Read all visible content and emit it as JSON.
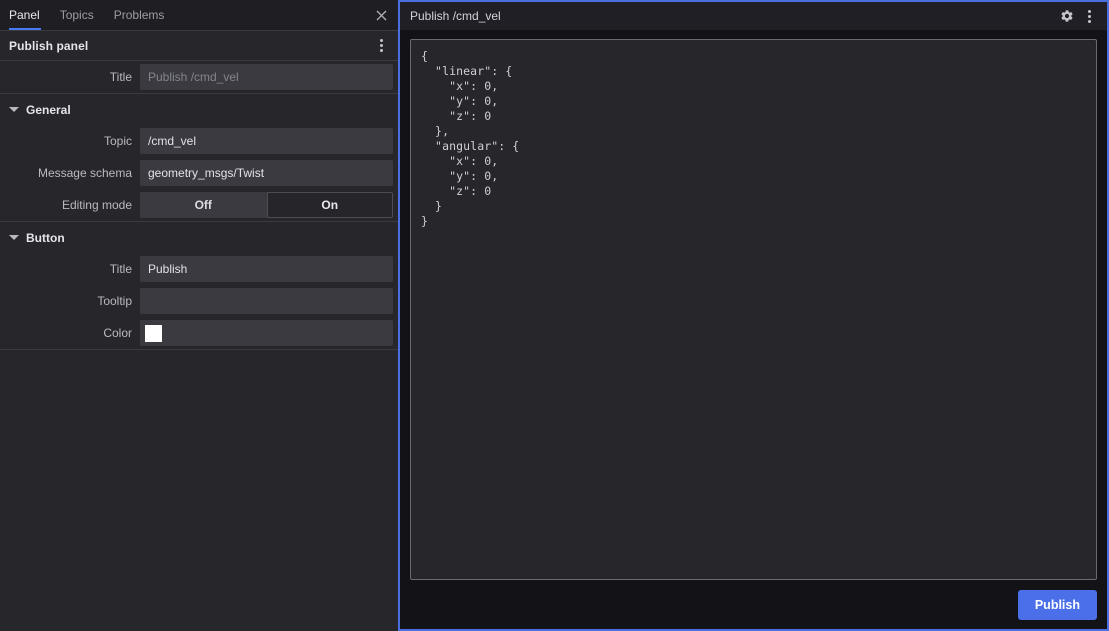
{
  "sidebar": {
    "tabs": [
      {
        "label": "Panel",
        "active": true
      },
      {
        "label": "Topics",
        "active": false
      },
      {
        "label": "Problems",
        "active": false
      }
    ],
    "close_icon": "close-icon",
    "panel_header": {
      "title": "Publish panel",
      "menu_icon": "kebab-menu-icon"
    },
    "title_row": {
      "label": "Title",
      "value": "",
      "placeholder": "Publish /cmd_vel"
    },
    "sections": [
      {
        "name": "general",
        "title": "General",
        "expanded": true,
        "caret_icon": "chevron-down-icon",
        "rows": [
          {
            "label": "Topic",
            "type": "text",
            "value": "/cmd_vel",
            "placeholder": ""
          },
          {
            "label": "Message schema",
            "type": "text",
            "value": "geometry_msgs/Twist",
            "placeholder": ""
          },
          {
            "label": "Editing mode",
            "type": "toggle",
            "options": [
              "Off",
              "On"
            ],
            "selected": "On"
          }
        ]
      },
      {
        "name": "button",
        "title": "Button",
        "expanded": true,
        "caret_icon": "chevron-down-icon",
        "rows": [
          {
            "label": "Title",
            "type": "text",
            "value": "Publish",
            "placeholder": ""
          },
          {
            "label": "Tooltip",
            "type": "text",
            "value": "",
            "placeholder": ""
          },
          {
            "label": "Color",
            "type": "color",
            "value": "transparent-swatch"
          }
        ]
      }
    ]
  },
  "right_panel": {
    "title": "Publish /cmd_vel",
    "settings_icon": "gear-icon",
    "menu_icon": "kebab-menu-icon",
    "editor": {
      "content": "{\n  \"linear\": {\n    \"x\": 0,\n    \"y\": 0,\n    \"z\": 0\n  },\n  \"angular\": {\n    \"x\": 0,\n    \"y\": 0,\n    \"z\": 0\n  }\n}"
    },
    "publish_button": {
      "label": "Publish"
    }
  },
  "colors": {
    "accent": "#4a6fe8",
    "tab_underline": "#4a7bf7",
    "panel_focus_border": "#4a6fe0",
    "sidebar_bg": "#27272b",
    "field_bg": "#3a3a40",
    "editor_bg": "#26262b",
    "app_bg": "#121217"
  }
}
